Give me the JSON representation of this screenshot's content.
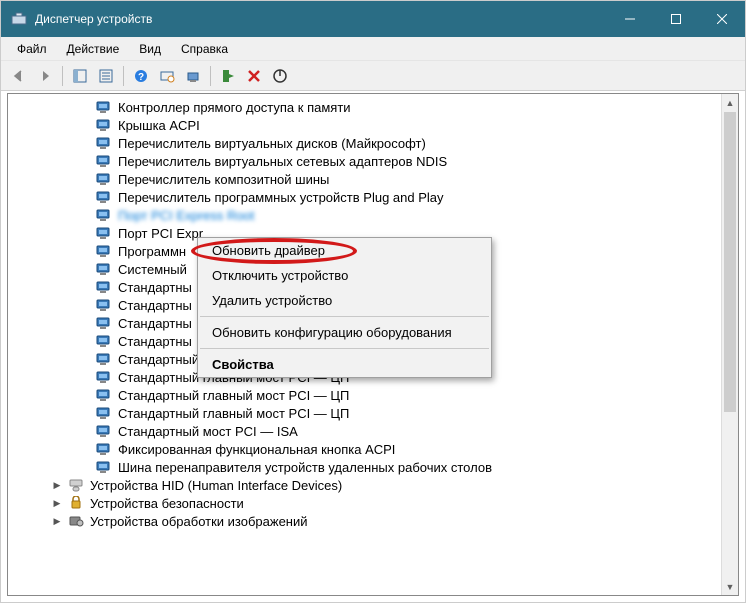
{
  "title": "Диспетчер устройств",
  "menu": {
    "file": "Файл",
    "action": "Действие",
    "view": "Вид",
    "help": "Справка"
  },
  "tree": {
    "items": [
      {
        "label": "Контроллер прямого доступа к памяти"
      },
      {
        "label": "Крышка ACPI"
      },
      {
        "label": "Перечислитель виртуальных дисков (Майкрософт)"
      },
      {
        "label": "Перечислитель виртуальных сетевых адаптеров NDIS"
      },
      {
        "label": "Перечислитель композитной шины"
      },
      {
        "label": "Перечислитель программных устройств Plug and Play"
      },
      {
        "label": "Порт PCI Express Root",
        "selected": true
      },
      {
        "label": "Порт PCI Expr"
      },
      {
        "label": "Программн"
      },
      {
        "label": "Системный"
      },
      {
        "label": "Стандартны"
      },
      {
        "label": "Стандартны"
      },
      {
        "label": "Стандартны"
      },
      {
        "label": "Стандартны"
      },
      {
        "label": "Стандартный главный мост PCI — ЦП"
      },
      {
        "label": "Стандартный главный мост PCI — ЦП"
      },
      {
        "label": "Стандартный главный мост PCI — ЦП"
      },
      {
        "label": "Стандартный главный мост PCI — ЦП"
      },
      {
        "label": "Стандартный мост PCI — ISA"
      },
      {
        "label": "Фиксированная функциональная кнопка ACPI"
      },
      {
        "label": "Шина перенаправителя устройств удаленных рабочих столов"
      }
    ],
    "categories": [
      {
        "label": "Устройства HID (Human Interface Devices)",
        "icon": "hid"
      },
      {
        "label": "Устройства безопасности",
        "icon": "sec"
      },
      {
        "label": "Устройства обработки изображений",
        "icon": "img"
      }
    ]
  },
  "context": {
    "update_driver": "Обновить драйвер",
    "disable_device": "Отключить устройство",
    "uninstall_device": "Удалить устройство",
    "scan_hardware": "Обновить конфигурацию оборудования",
    "properties": "Свойства"
  }
}
